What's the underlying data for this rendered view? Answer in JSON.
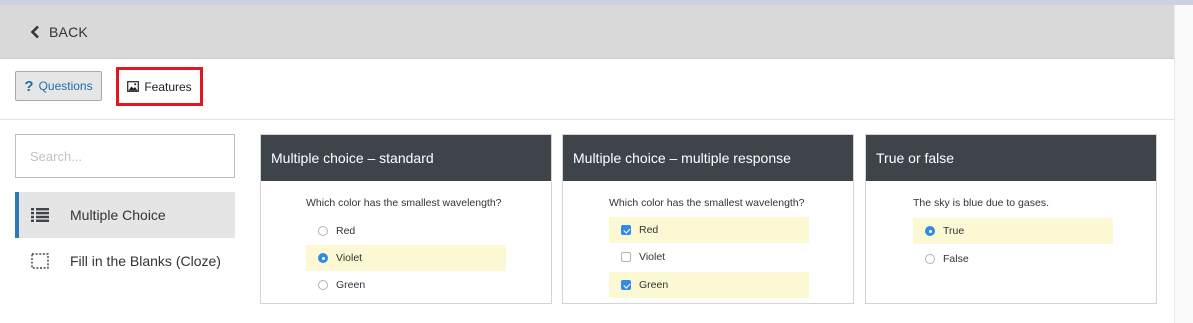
{
  "header": {
    "back_label": "BACK"
  },
  "toolbar": {
    "questions_label": "Questions",
    "features_label": "Features"
  },
  "sidebar": {
    "search_placeholder": "Search...",
    "items": [
      {
        "label": "Multiple Choice",
        "icon": "list-icon",
        "active": true
      },
      {
        "label": "Fill in the Blanks (Cloze)",
        "icon": "dashed-box-icon",
        "active": false
      }
    ]
  },
  "cards": [
    {
      "title": "Multiple choice – standard",
      "question": "Which color has the smallest wavelength?",
      "options": [
        {
          "label": "Red",
          "selected": false
        },
        {
          "label": "Violet",
          "selected": true
        },
        {
          "label": "Green",
          "selected": false
        }
      ]
    },
    {
      "title": "Multiple choice – multiple response",
      "question": "Which color has the smallest wavelength?",
      "options": [
        {
          "label": "Red",
          "selected": true
        },
        {
          "label": "Violet",
          "selected": false
        },
        {
          "label": "Green",
          "selected": true
        }
      ]
    },
    {
      "title": "True or false",
      "question": "The sky is blue due to gases.",
      "options": [
        {
          "label": "True",
          "selected": true
        },
        {
          "label": "False",
          "selected": false
        }
      ]
    }
  ],
  "colors": {
    "accent": "#2f8be6",
    "header_bg": "#d9d9d9",
    "card_head": "#3f444b",
    "highlight": "#fbf8d3",
    "feature_outline": "#e4151f"
  }
}
